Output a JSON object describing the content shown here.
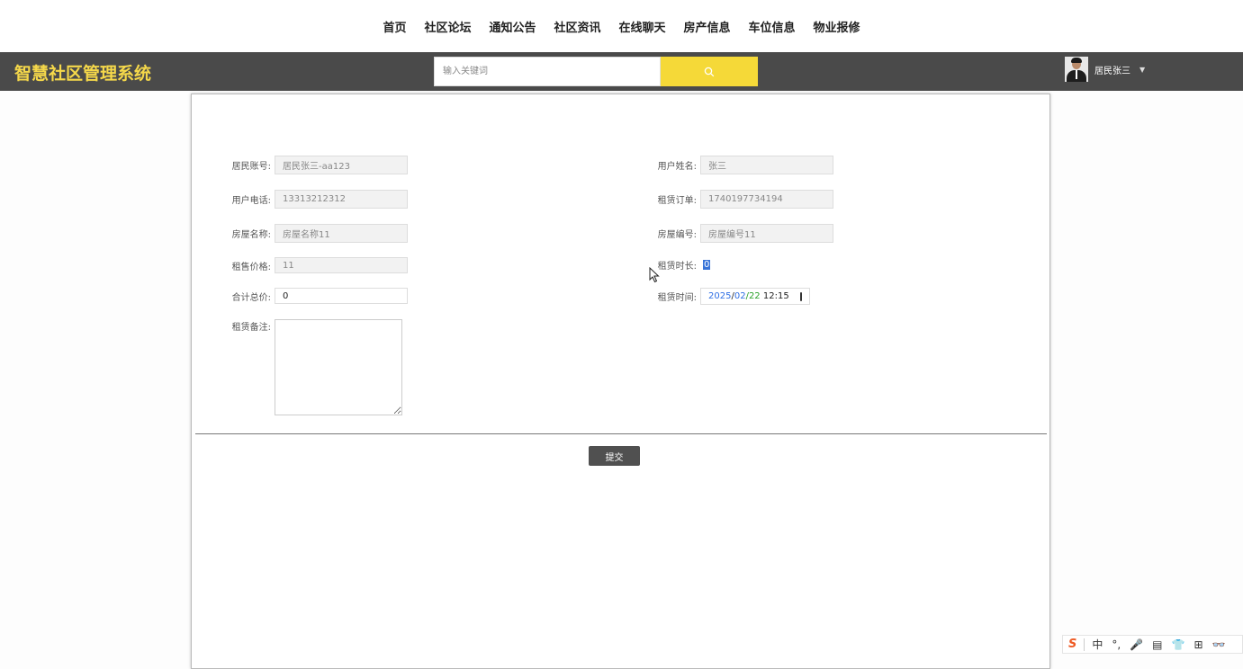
{
  "nav": {
    "items": [
      "首页",
      "社区论坛",
      "通知公告",
      "社区资讯",
      "在线聊天",
      "房产信息",
      "车位信息",
      "物业报修"
    ]
  },
  "header": {
    "brand": "智慧社区管理系统",
    "search_placeholder": "输入关键词",
    "user_name": "居民张三",
    "brand_color": "#f5d84a",
    "search_button_color": "#f5d938"
  },
  "form": {
    "account_label": "居民账号:",
    "account_value": "居民张三-aa123",
    "username_label": "用户姓名:",
    "username_value": "张三",
    "phone_label": "用户电话:",
    "phone_value": "13313212312",
    "order_label": "租赁订单:",
    "order_value": "1740197734194",
    "house_name_label": "房屋名称:",
    "house_name_value": "房屋名称11",
    "house_no_label": "房屋编号:",
    "house_no_value": "房屋编号11",
    "price_label": "租售价格:",
    "price_value": "11",
    "duration_label": "租赁时长:",
    "duration_value": "0",
    "total_label": "合计总价:",
    "total_value": "0",
    "date_label": "租赁时间:",
    "date_year": "2025",
    "date_month": "02",
    "date_day": "22",
    "date_time": "12:15",
    "memo_label": "租赁备注:",
    "submit_label": "提交"
  },
  "ime": {
    "items": [
      "中",
      "°,",
      "🎤",
      "▤",
      "👕",
      "⊞",
      "👓"
    ]
  }
}
